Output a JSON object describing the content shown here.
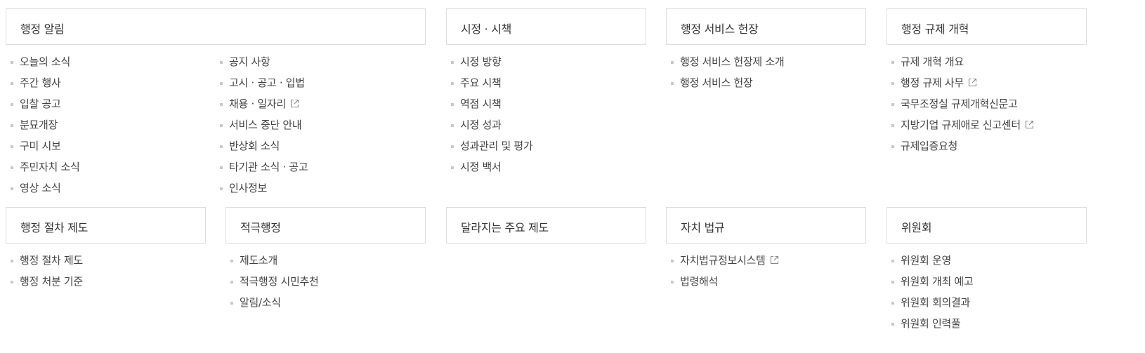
{
  "sections": {
    "admin_notice": {
      "title": "행정 알림",
      "col1": [
        "오늘의 소식",
        "주간 행사",
        "입찰 공고",
        "분묘개장",
        "구미 시보",
        "주민자치 소식",
        "영상 소식"
      ],
      "col2": [
        "공지 사항",
        "고시 · 공고 · 입법",
        "채용 · 일자리",
        "서비스 중단 안내",
        "반상회 소식",
        "타기관 소식 · 공고",
        "인사정보"
      ]
    },
    "policy": {
      "title": "시정 · 시책",
      "items": [
        "시정 방향",
        "주요 시책",
        "역점 시책",
        "시정 성과",
        "성과관리 및 평가",
        "시정 백서"
      ]
    },
    "service_charter": {
      "title": "행정 서비스 헌장",
      "items": [
        "행정 서비스 헌장제 소개",
        "행정 서비스 헌장"
      ]
    },
    "regulation_reform": {
      "title": "행정 규제 개혁",
      "items": [
        "규제 개혁 개요",
        "행정 규제 사무",
        "국무조정실 규제개혁신문고",
        "지방기업 규제애로 신고센터",
        "규제입증요청"
      ]
    },
    "procedure": {
      "title": "행정 절차 제도",
      "items": [
        "행정 절차 제도",
        "행정 처분 기준"
      ]
    },
    "proactive": {
      "title": "적극행정",
      "items": [
        "제도소개",
        "적극행정 시민추천",
        "알림/소식"
      ]
    },
    "changing_systems": {
      "title": "달라지는 주요 제도"
    },
    "ordinance": {
      "title": "자치 법규",
      "items": [
        "자치법규정보시스템",
        "법령해석"
      ]
    },
    "committee": {
      "title": "위원회",
      "items": [
        "위원회 운영",
        "위원회 개최 예고",
        "위원회 회의결과",
        "위원회 인력풀"
      ]
    }
  },
  "icons": {
    "external_link": "external-link-icon"
  },
  "colors": {
    "border": "#dddddd",
    "bullet": "#c8c8c8",
    "text": "#444444",
    "title": "#333333"
  }
}
